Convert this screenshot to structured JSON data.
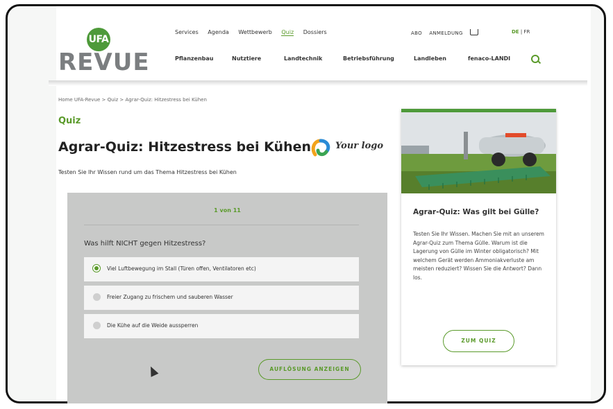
{
  "logo": {
    "badge": "UFA",
    "word": "REVUE"
  },
  "top_nav": [
    "Services",
    "Agenda",
    "Wettbewerb",
    "Quiz",
    "Dossiers"
  ],
  "top_nav_active": "Quiz",
  "account": {
    "abo": "ABO",
    "login": "ANMELDUNG"
  },
  "languages": {
    "de": "DE",
    "sep": "|",
    "fr": "FR"
  },
  "main_nav": [
    "Pflanzenbau",
    "Nutztiere",
    "Landtechnik",
    "Betriebsführung",
    "Landleben",
    "fenaco-LANDI"
  ],
  "breadcrumb": "Home UFA-Revue > Quiz > Agrar-Quiz: Hitzestress bei Kühen",
  "section": "Quiz",
  "page_title": "Agrar-Quiz: Hitzestress bei Kühen",
  "sponsor_logo_text": "Your logo",
  "intro": "Testen Sie Ihr Wissen rund um das Thema Hitzestress bei Kühen",
  "quiz": {
    "counter": "1 von 11",
    "question": "Was hilft NICHT gegen Hitzestress?",
    "options": [
      {
        "label": "Viel Luftbewegung im Stall (Türen offen, Ventilatoren etc)",
        "selected": true
      },
      {
        "label": "Freier Zugang zu frischem und sauberen Wasser",
        "selected": false
      },
      {
        "label": "Die Kühe auf die Weide aussperren",
        "selected": false
      }
    ],
    "solve_button": "AUFLÖSUNG ANZEIGEN"
  },
  "side_card": {
    "title": "Agrar-Quiz: Was gilt bei Gülle?",
    "text": "Testen Sie Ihr Wissen. Machen Sie mit an unserem Agrar-Quiz zum Thema Gülle. Warum ist die Lagerung von Gülle im Winter obligatorisch? Mit welchem Gerät werden Ammoniakverluste am meisten reduziert? Wissen Sie die Antwort? Dann los.",
    "button": "ZUM QUIZ"
  },
  "colors": {
    "brand_green": "#5a9a2a",
    "quiz_bg": "#c8c9c8",
    "logo_grey": "#7b7e80"
  }
}
